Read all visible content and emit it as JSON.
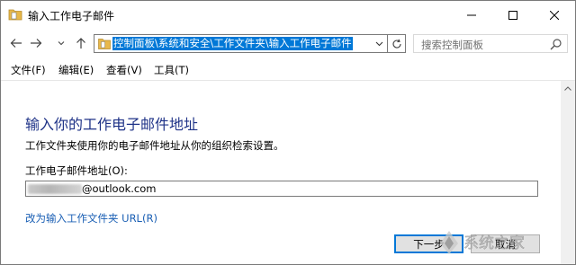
{
  "window": {
    "title": "输入工作电子邮件"
  },
  "nav": {
    "address": "控制面板\\系统和安全\\工作文件夹\\输入工作电子邮件",
    "search_placeholder": "搜索控制面板"
  },
  "menu": {
    "file": "文件(F)",
    "edit": "编辑(E)",
    "view": "查看(V)",
    "tools": "工具(T)"
  },
  "content": {
    "heading": "输入你的工作电子邮件地址",
    "description": "工作文件夹使用你的电子邮件地址从你的组织检索设置。",
    "field_label": "工作电子邮件地址(O):",
    "email_value": "@outlook.com",
    "url_link": "改为输入工作文件夹 URL(R)",
    "next_button": "下一步",
    "cancel_button": "取消"
  },
  "watermark": {
    "text": "系统之家"
  },
  "colors": {
    "heading": "#1e3287",
    "link": "#1a5fb4",
    "selection": "#0078d7",
    "folder": "#e8b84a"
  }
}
